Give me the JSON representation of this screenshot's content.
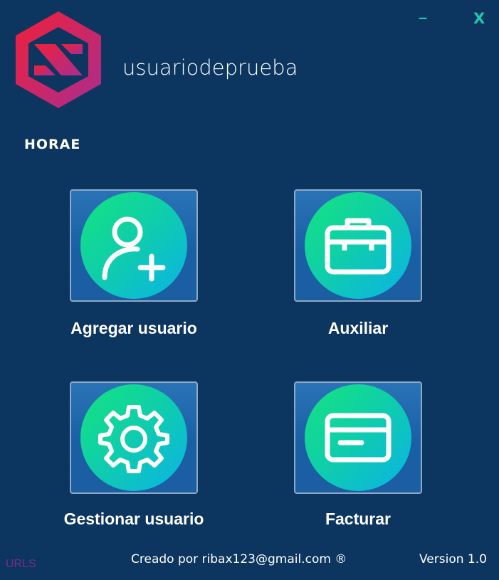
{
  "window": {
    "minimize_label": "–",
    "close_label": "X"
  },
  "header": {
    "brand": "HORAE",
    "username": "usuariodeprueba"
  },
  "tiles": [
    {
      "label": "Agregar usuario",
      "icon": "add-user-icon"
    },
    {
      "label": "Auxiliar",
      "icon": "toolbox-icon"
    },
    {
      "label": "Gestionar usuario",
      "icon": "gear-icon"
    },
    {
      "label": "Facturar",
      "icon": "credit-card-icon"
    }
  ],
  "footer": {
    "urls": "URLS",
    "credit": "Creado por ribax123@gmail.com ®",
    "version": "Version 1.0"
  },
  "colors": {
    "background": "#0c3560",
    "accent": "#1dc8b0",
    "logo_gradient": [
      "#e8233c",
      "#b02a8a"
    ],
    "icon_gradient": [
      "#15e37e",
      "#0bb2e8"
    ]
  }
}
